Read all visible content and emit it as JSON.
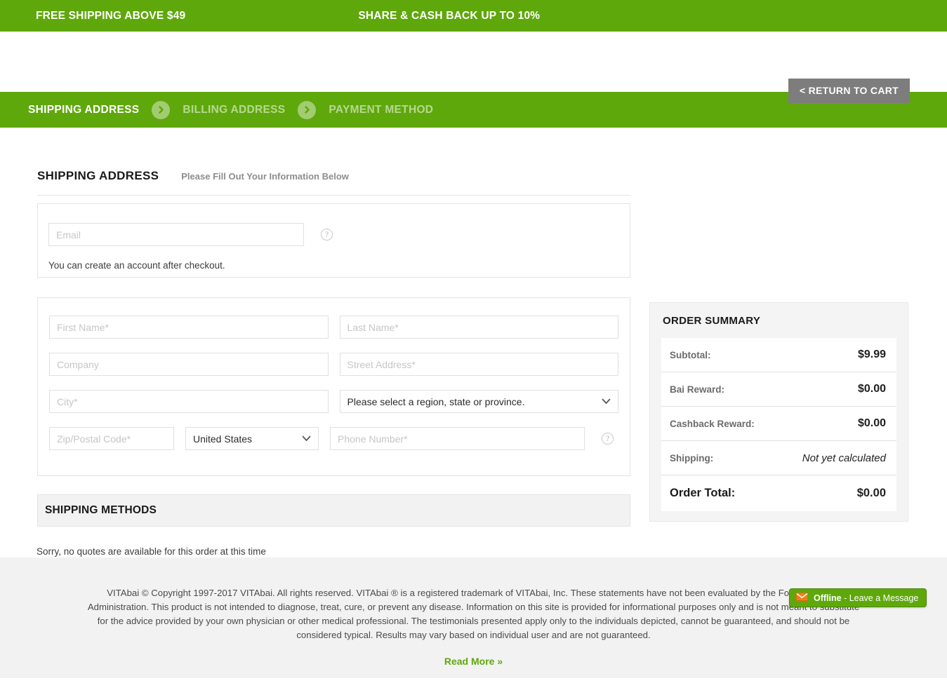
{
  "promo": {
    "shipping_text": "FREE SHIPPING ABOVE $49",
    "cashback_text": "SHARE & CASH BACK UP TO 10%"
  },
  "header": {
    "return_to_cart": "< RETURN TO CART"
  },
  "steps": [
    {
      "label": "SHIPPING ADDRESS",
      "state": "active"
    },
    {
      "label": "BILLING ADDRESS",
      "state": "inactive"
    },
    {
      "label": "PAYMENT METHOD",
      "state": "inactive"
    }
  ],
  "shipping_section": {
    "title": "SHIPPING ADDRESS",
    "subtitle": "Please Fill Out Your Information Below",
    "email": {
      "placeholder": "Email",
      "value": "",
      "note": "You can create an account after checkout."
    },
    "fields": {
      "first_name": "First Name*",
      "last_name": "Last Name*",
      "company": "Company",
      "street_address": "Street Address*",
      "city": "City*",
      "region": "Please select a region, state or province.",
      "zip": "Zip/Postal Code*",
      "country": "United States",
      "phone": "Phone Number*"
    }
  },
  "shipping_methods": {
    "title": "SHIPPING METHODS",
    "message": "Sorry, no quotes are available for this order at this time"
  },
  "order_summary": {
    "title": "ORDER SUMMARY",
    "rows": [
      {
        "label": "Subtotal:",
        "value": "$9.99",
        "style": "normal"
      },
      {
        "label": "Bai Reward:",
        "value": "$0.00",
        "style": "normal"
      },
      {
        "label": "Cashback Reward:",
        "value": "$0.00",
        "style": "normal"
      },
      {
        "label": "Shipping:",
        "value": "Not yet calculated",
        "style": "italic"
      },
      {
        "label": "Order Total:",
        "value": "$0.00",
        "style": "total"
      }
    ]
  },
  "chat": {
    "status": "Offline",
    "action": " - Leave a Message"
  },
  "footer": {
    "disclaimer": "VITAbai © Copyright 1997-2017 VITAbai. All rights reserved. VITAbai ® is a registered trademark of VITAbai, Inc.  These statements have not been evaluated by the Food and Drug Administration. This product is not intended to diagnose, treat, cure, or prevent any disease. Information on this site is provided for informational purposes only and is not meant to substitute for the advice provided by your own physician or other medical professional. The testimonials presented apply only to the individuals depicted, cannot be guaranteed, and should not be considered typical. Results may vary based on individual user and are not guaranteed.",
    "read_more": "Read More »"
  },
  "colors": {
    "brand_green": "#5fa80c",
    "button_gray": "#7d7d7d",
    "panel_gray": "#f4f4f4",
    "footer_gray": "#f2f2f2"
  }
}
